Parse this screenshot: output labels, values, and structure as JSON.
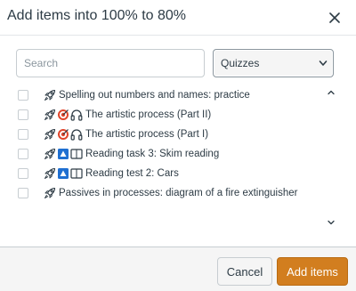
{
  "dialog": {
    "title": "Add items into 100% to 80%",
    "close_icon": "close-icon"
  },
  "search": {
    "placeholder": "Search",
    "value": ""
  },
  "filter": {
    "selected": "Quizzes"
  },
  "items": [
    {
      "label": "Spelling out numbers and names: practice",
      "checked": false,
      "icons": [
        "rocket-icon"
      ]
    },
    {
      "label": "The artistic process (Part II)",
      "checked": false,
      "icons": [
        "rocket-icon",
        "target-icon",
        "headphones-icon"
      ]
    },
    {
      "label": "The artistic process (Part I)",
      "checked": false,
      "icons": [
        "rocket-icon",
        "target-icon",
        "headphones-icon"
      ]
    },
    {
      "label": "Reading task 3: Skim reading",
      "checked": false,
      "icons": [
        "rocket-icon",
        "triangle-warning-icon",
        "book-icon"
      ]
    },
    {
      "label": "Reading test 2: Cars",
      "checked": false,
      "icons": [
        "rocket-icon",
        "triangle-warning-icon",
        "book-icon"
      ]
    },
    {
      "label": "Passives in processes: diagram of a fire extinguisher",
      "checked": false,
      "icons": [
        "rocket-icon"
      ]
    }
  ],
  "footer": {
    "cancel_label": "Cancel",
    "add_label": "Add items"
  },
  "colors": {
    "accent": "#d27e1f",
    "text": "#2d3b45",
    "target_red": "#e0452b",
    "triangle_blue": "#1f6fd1"
  }
}
